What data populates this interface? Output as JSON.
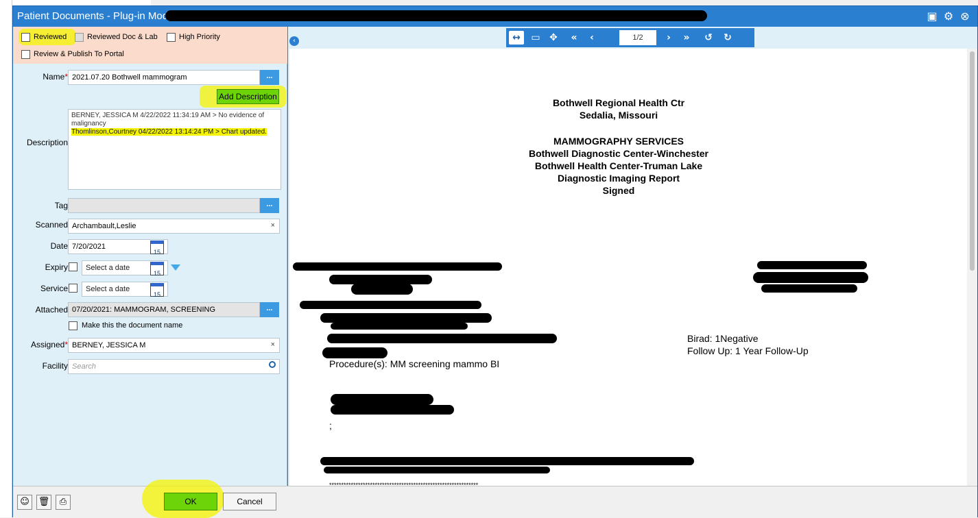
{
  "window": {
    "title": "Patient Documents - Plug-in Mode"
  },
  "title_icons": [
    "minimize-icon",
    "gear-icon",
    "close-icon"
  ],
  "checks": {
    "reviewed": "Reviewed",
    "reviewed_doc_lab": "Reviewed Doc & Lab",
    "high_priority": "High Priority",
    "publish": "Review & Publish To Portal"
  },
  "form": {
    "name_label": "Name",
    "name_value": "2021.07.20 Bothwell mammogram",
    "name_dots": "...",
    "add_description": "Add Description",
    "description_label": "Description",
    "description_line1": "BERNEY, JESSICA M 4/22/2022 11:34:19 AM > No evidence of malignancy",
    "description_line2": "Thomlinson,Courtney  04/22/2022 13:14:24 PM > Chart updated.",
    "tag_label": "Tag",
    "tag_dots": "...",
    "scanned_label": "Scanned",
    "scanned_value": "Archambault,Leslie",
    "date_label": "Date",
    "date_value": "7/20/2021",
    "expiry_label": "Expiry",
    "expiry_placeholder": "Select a date",
    "service_label": "Service",
    "service_placeholder": "Select a date",
    "attached_label": "Attached",
    "attached_value": "07/20/2021: MAMMOGRAM, SCREENING",
    "attached_dots": "...",
    "make_doc_name": "Make this the document name",
    "assigned_label": "Assigned",
    "assigned_value": "BERNEY, JESSICA M",
    "facility_label": "Facility",
    "facility_placeholder": "Search",
    "clear": "×",
    "cal_day": "15",
    "required_mark": "*"
  },
  "buttons": {
    "ok": "OK",
    "cancel": "Cancel"
  },
  "viewer": {
    "page": "1/2"
  },
  "document": {
    "header": [
      "Bothwell Regional Health Ctr",
      "Sedalia, Missouri",
      "MAMMOGRAPHY SERVICES",
      "Bothwell Diagnostic Center-Winchester",
      "Bothwell Health Center-Truman Lake",
      "Diagnostic Imaging Report",
      "Signed"
    ],
    "birad": "Birad: 1Negative",
    "follow_up": "Follow Up: 1 Year Follow-Up",
    "procedure": "Procedure(s): MM screening mammo BI",
    "semicolon": ";",
    "stars": "**************************************************************"
  },
  "colors": {
    "title_blue": "#2b7fd1",
    "highlight": "#f4f400",
    "ok_green": "#6ed40a",
    "peach": "#fbdccc",
    "panel": "#dff0f9"
  }
}
